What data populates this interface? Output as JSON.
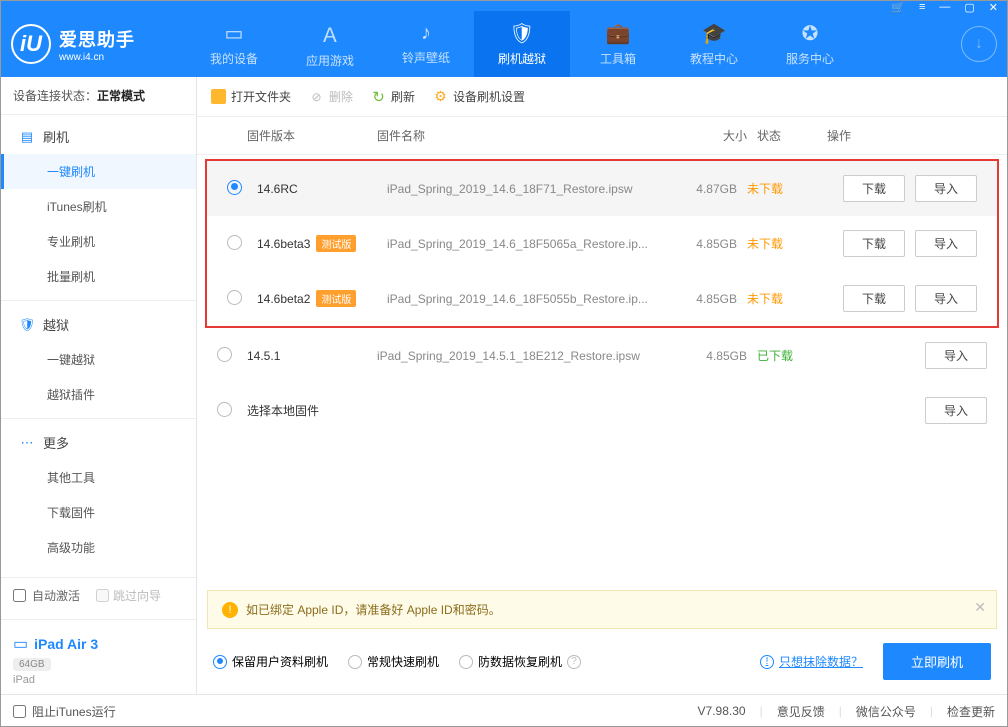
{
  "app": {
    "name": "爱思助手",
    "url": "www.i4.cn"
  },
  "titlebar_icons": [
    "🛒",
    "≡",
    "—",
    "▢",
    "✕"
  ],
  "nav": [
    {
      "icon": "▭",
      "label": "我的设备"
    },
    {
      "icon": "Ａ",
      "label": "应用游戏"
    },
    {
      "icon": "♪",
      "label": "铃声壁纸"
    },
    {
      "icon": "🛡",
      "label": "刷机越狱",
      "active": true
    },
    {
      "icon": "💼",
      "label": "工具箱"
    },
    {
      "icon": "🎓",
      "label": "教程中心"
    },
    {
      "icon": "✪",
      "label": "服务中心"
    }
  ],
  "status": {
    "label": "设备连接状态：",
    "value": "正常模式"
  },
  "sidebar": {
    "groups": [
      {
        "icon": "▤",
        "label": "刷机",
        "items": [
          "一键刷机",
          "iTunes刷机",
          "专业刷机",
          "批量刷机"
        ],
        "active": 0
      },
      {
        "icon": "🛡",
        "label": "越狱",
        "items": [
          "一键越狱",
          "越狱插件"
        ]
      },
      {
        "icon": "⋯",
        "label": "更多",
        "items": [
          "其他工具",
          "下载固件",
          "高级功能"
        ]
      }
    ],
    "auto_activate": "自动激活",
    "skip_wizard": "跳过向导",
    "device": {
      "name": "iPad Air 3",
      "storage": "64GB",
      "type": "iPad"
    }
  },
  "toolbar": {
    "open_folder": "打开文件夹",
    "delete": "删除",
    "refresh": "刷新",
    "settings": "设备刷机设置"
  },
  "columns": {
    "version": "固件版本",
    "name": "固件名称",
    "size": "大小",
    "status": "状态",
    "ops": "操作"
  },
  "beta_tag": "测试版",
  "btn": {
    "download": "下载",
    "import": "导入"
  },
  "firmware": [
    {
      "version": "14.6RC",
      "beta": false,
      "name": "iPad_Spring_2019_14.6_18F71_Restore.ipsw",
      "size": "4.87GB",
      "status": "未下载",
      "status_cls": "orange",
      "selected": true,
      "highlight": true,
      "dl": true
    },
    {
      "version": "14.6beta3",
      "beta": true,
      "name": "iPad_Spring_2019_14.6_18F5065a_Restore.ip...",
      "size": "4.85GB",
      "status": "未下载",
      "status_cls": "orange",
      "highlight": true,
      "dl": true
    },
    {
      "version": "14.6beta2",
      "beta": true,
      "name": "iPad_Spring_2019_14.6_18F5055b_Restore.ip...",
      "size": "4.85GB",
      "status": "未下载",
      "status_cls": "orange",
      "highlight": true,
      "dl": true
    },
    {
      "version": "14.5.1",
      "beta": false,
      "name": "iPad_Spring_2019_14.5.1_18E212_Restore.ipsw",
      "size": "4.85GB",
      "status": "已下载",
      "status_cls": "green",
      "dl": false
    },
    {
      "version": "选择本地固件",
      "beta": false,
      "name": "",
      "size": "",
      "status": "",
      "status_cls": "",
      "local": true
    }
  ],
  "tip": "如已绑定 Apple ID，请准备好 Apple ID和密码。",
  "options": {
    "keep_data": "保留用户资料刷机",
    "normal": "常规快速刷机",
    "anti_recovery": "防数据恢复刷机",
    "erase_link": "只想抹除数据？",
    "flash_btn": "立即刷机"
  },
  "footer": {
    "block_itunes": "阻止iTunes运行",
    "version": "V7.98.30",
    "feedback": "意见反馈",
    "wechat": "微信公众号",
    "update": "检查更新"
  }
}
